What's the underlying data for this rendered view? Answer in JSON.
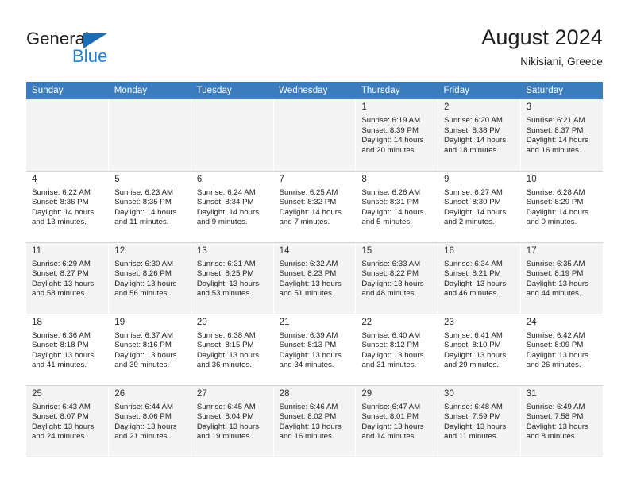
{
  "brand": {
    "name_part1": "General",
    "name_part2": "Blue",
    "triangle_color": "#1a6cb5",
    "blue_color": "#1e7fd4"
  },
  "header": {
    "title": "August 2024",
    "location": "Nikisiani, Greece"
  },
  "theme": {
    "header_row_bg": "#3b7cbf",
    "shaded_row_bg": "#f4f4f4",
    "grid_line": "#d4d4d4",
    "text": "#1c1c1c"
  },
  "columns": [
    "Sunday",
    "Monday",
    "Tuesday",
    "Wednesday",
    "Thursday",
    "Friday",
    "Saturday"
  ],
  "weeks": [
    {
      "shaded": true,
      "days": [
        {
          "num": "",
          "detail": ""
        },
        {
          "num": "",
          "detail": ""
        },
        {
          "num": "",
          "detail": ""
        },
        {
          "num": "",
          "detail": ""
        },
        {
          "num": "1",
          "detail": "Sunrise: 6:19 AM\nSunset: 8:39 PM\nDaylight: 14 hours\nand 20 minutes."
        },
        {
          "num": "2",
          "detail": "Sunrise: 6:20 AM\nSunset: 8:38 PM\nDaylight: 14 hours\nand 18 minutes."
        },
        {
          "num": "3",
          "detail": "Sunrise: 6:21 AM\nSunset: 8:37 PM\nDaylight: 14 hours\nand 16 minutes."
        }
      ]
    },
    {
      "shaded": false,
      "days": [
        {
          "num": "4",
          "detail": "Sunrise: 6:22 AM\nSunset: 8:36 PM\nDaylight: 14 hours\nand 13 minutes."
        },
        {
          "num": "5",
          "detail": "Sunrise: 6:23 AM\nSunset: 8:35 PM\nDaylight: 14 hours\nand 11 minutes."
        },
        {
          "num": "6",
          "detail": "Sunrise: 6:24 AM\nSunset: 8:34 PM\nDaylight: 14 hours\nand 9 minutes."
        },
        {
          "num": "7",
          "detail": "Sunrise: 6:25 AM\nSunset: 8:32 PM\nDaylight: 14 hours\nand 7 minutes."
        },
        {
          "num": "8",
          "detail": "Sunrise: 6:26 AM\nSunset: 8:31 PM\nDaylight: 14 hours\nand 5 minutes."
        },
        {
          "num": "9",
          "detail": "Sunrise: 6:27 AM\nSunset: 8:30 PM\nDaylight: 14 hours\nand 2 minutes."
        },
        {
          "num": "10",
          "detail": "Sunrise: 6:28 AM\nSunset: 8:29 PM\nDaylight: 14 hours\nand 0 minutes."
        }
      ]
    },
    {
      "shaded": true,
      "days": [
        {
          "num": "11",
          "detail": "Sunrise: 6:29 AM\nSunset: 8:27 PM\nDaylight: 13 hours\nand 58 minutes."
        },
        {
          "num": "12",
          "detail": "Sunrise: 6:30 AM\nSunset: 8:26 PM\nDaylight: 13 hours\nand 56 minutes."
        },
        {
          "num": "13",
          "detail": "Sunrise: 6:31 AM\nSunset: 8:25 PM\nDaylight: 13 hours\nand 53 minutes."
        },
        {
          "num": "14",
          "detail": "Sunrise: 6:32 AM\nSunset: 8:23 PM\nDaylight: 13 hours\nand 51 minutes."
        },
        {
          "num": "15",
          "detail": "Sunrise: 6:33 AM\nSunset: 8:22 PM\nDaylight: 13 hours\nand 48 minutes."
        },
        {
          "num": "16",
          "detail": "Sunrise: 6:34 AM\nSunset: 8:21 PM\nDaylight: 13 hours\nand 46 minutes."
        },
        {
          "num": "17",
          "detail": "Sunrise: 6:35 AM\nSunset: 8:19 PM\nDaylight: 13 hours\nand 44 minutes."
        }
      ]
    },
    {
      "shaded": false,
      "days": [
        {
          "num": "18",
          "detail": "Sunrise: 6:36 AM\nSunset: 8:18 PM\nDaylight: 13 hours\nand 41 minutes."
        },
        {
          "num": "19",
          "detail": "Sunrise: 6:37 AM\nSunset: 8:16 PM\nDaylight: 13 hours\nand 39 minutes."
        },
        {
          "num": "20",
          "detail": "Sunrise: 6:38 AM\nSunset: 8:15 PM\nDaylight: 13 hours\nand 36 minutes."
        },
        {
          "num": "21",
          "detail": "Sunrise: 6:39 AM\nSunset: 8:13 PM\nDaylight: 13 hours\nand 34 minutes."
        },
        {
          "num": "22",
          "detail": "Sunrise: 6:40 AM\nSunset: 8:12 PM\nDaylight: 13 hours\nand 31 minutes."
        },
        {
          "num": "23",
          "detail": "Sunrise: 6:41 AM\nSunset: 8:10 PM\nDaylight: 13 hours\nand 29 minutes."
        },
        {
          "num": "24",
          "detail": "Sunrise: 6:42 AM\nSunset: 8:09 PM\nDaylight: 13 hours\nand 26 minutes."
        }
      ]
    },
    {
      "shaded": true,
      "days": [
        {
          "num": "25",
          "detail": "Sunrise: 6:43 AM\nSunset: 8:07 PM\nDaylight: 13 hours\nand 24 minutes."
        },
        {
          "num": "26",
          "detail": "Sunrise: 6:44 AM\nSunset: 8:06 PM\nDaylight: 13 hours\nand 21 minutes."
        },
        {
          "num": "27",
          "detail": "Sunrise: 6:45 AM\nSunset: 8:04 PM\nDaylight: 13 hours\nand 19 minutes."
        },
        {
          "num": "28",
          "detail": "Sunrise: 6:46 AM\nSunset: 8:02 PM\nDaylight: 13 hours\nand 16 minutes."
        },
        {
          "num": "29",
          "detail": "Sunrise: 6:47 AM\nSunset: 8:01 PM\nDaylight: 13 hours\nand 14 minutes."
        },
        {
          "num": "30",
          "detail": "Sunrise: 6:48 AM\nSunset: 7:59 PM\nDaylight: 13 hours\nand 11 minutes."
        },
        {
          "num": "31",
          "detail": "Sunrise: 6:49 AM\nSunset: 7:58 PM\nDaylight: 13 hours\nand 8 minutes."
        }
      ]
    }
  ]
}
